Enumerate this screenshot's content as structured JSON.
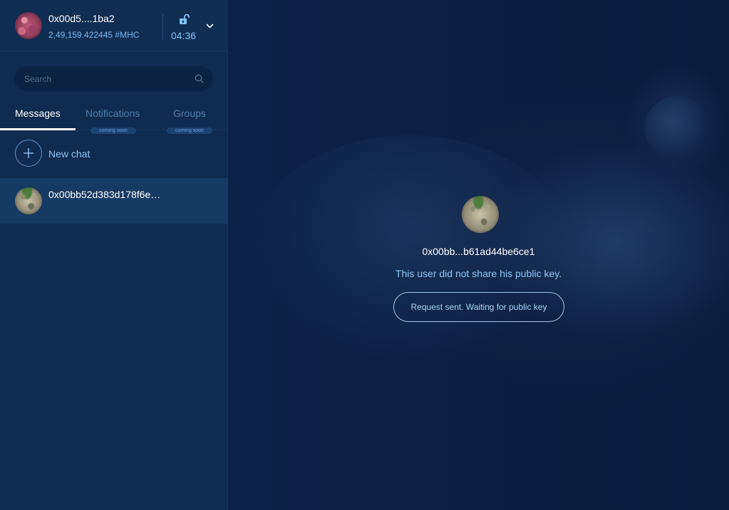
{
  "account": {
    "name": "0x00d5....1ba2",
    "balance": "2,49,159.422445 #MHC",
    "time": "04:36",
    "lock_icon": "unlock-icon",
    "menu_icon": "chevron-down-icon"
  },
  "search": {
    "placeholder": "Search"
  },
  "tabs": [
    {
      "label": "Messages",
      "active": true
    },
    {
      "label": "Notifications",
      "badge": "coming soon"
    },
    {
      "label": "Groups",
      "badge": "coming soon"
    }
  ],
  "new_chat": {
    "label": "New chat"
  },
  "chats": [
    {
      "name": "0x00bb52d383d178f6e…",
      "selected": true
    }
  ],
  "contact": {
    "name": "0x00bb...b61ad44be6ce1",
    "status": "This user did not share his public key.",
    "button_label": "Request sent. Waiting for public key"
  },
  "colors": {
    "sidebar_bg": "#0f2b50",
    "accent": "#8cc6f8",
    "selected_row": "#163a63"
  }
}
